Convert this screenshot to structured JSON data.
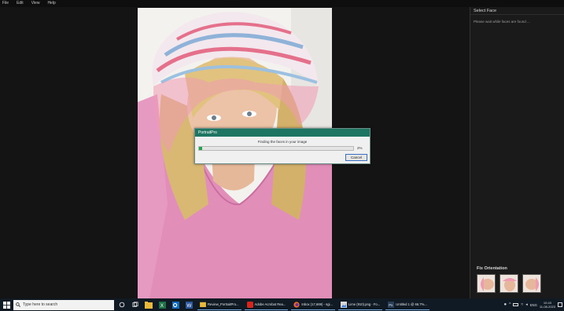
{
  "menu": [
    "File",
    "Edit",
    "View",
    "Help"
  ],
  "panel": {
    "title": "Select Face",
    "message": "Please wait while faces are found ...",
    "orientation_title": "Fix Orientation"
  },
  "dialog": {
    "title": "PortraitPro",
    "message": "Finding the faces in your image",
    "progress_percent": 2,
    "progress_label": "2%",
    "cancel_label": "Cancel"
  },
  "taskbar": {
    "search_placeholder": "Type here to search",
    "apps": [
      {
        "label": "Review_PortraitPro..."
      },
      {
        "label": "Adobe Acrobat Rea..."
      },
      {
        "label": "Inbox (17,669) - sgi..."
      },
      {
        "label": "Lime (910).png - Fo..."
      },
      {
        "label": "Untitled 1 @ 66.7%..."
      }
    ],
    "language": "ENG",
    "time": "10:43",
    "date": "11-08-2023"
  },
  "colors": {
    "dialog_title_bg": "#1e7561",
    "progress_fill": "#21a74b",
    "taskbar_bg": "#101a25"
  }
}
